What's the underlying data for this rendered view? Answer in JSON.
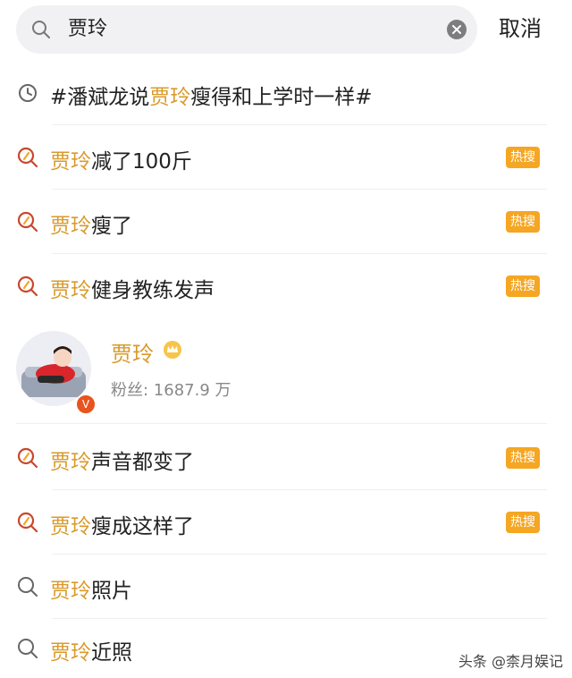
{
  "search": {
    "query": "贾玲"
  },
  "header": {
    "cancel_label": "取消"
  },
  "history": [
    {
      "prefix": "#潘斌龙说",
      "highlight": "贾玲",
      "suffix": "瘦得和上学时一样#",
      "icon": "clock-icon"
    }
  ],
  "suggestions": [
    {
      "highlight": "贾玲",
      "suffix": "减了100斤",
      "badge": "热搜"
    },
    {
      "highlight": "贾玲",
      "suffix": "瘦了",
      "badge": "热搜"
    },
    {
      "highlight": "贾玲",
      "suffix": "健身教练发声",
      "badge": "热搜"
    }
  ],
  "user_card": {
    "name": "贾玲",
    "followers_label": "粉丝: 1687.9 万",
    "verified": "V"
  },
  "suggestions_more": [
    {
      "highlight": "贾玲",
      "suffix": "声音都变了",
      "badge": "热搜"
    },
    {
      "highlight": "贾玲",
      "suffix": "瘦成这样了",
      "badge": "热搜"
    },
    {
      "highlight": "贾玲",
      "suffix": "照片"
    },
    {
      "highlight": "贾玲",
      "suffix": "近照"
    }
  ],
  "watermark": "头条 @柰月娱记",
  "colors": {
    "accent": "#d99a2b",
    "hot_badge": "#f5a623",
    "hot_icon": "#c8482e"
  }
}
